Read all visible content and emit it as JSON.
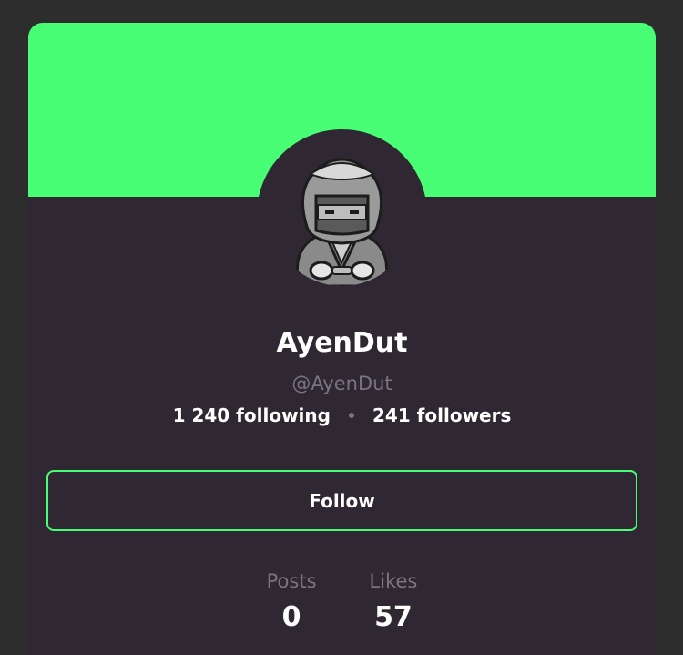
{
  "profile": {
    "display_name": "AyenDut",
    "handle": "@AyenDut",
    "following": "1 240 following",
    "followers": "241 followers",
    "follow_label": "Follow",
    "avatar_icon": "hooded-ninja-avatar-icon"
  },
  "counters": [
    {
      "label": "Posts",
      "value": "0"
    },
    {
      "label": "Likes",
      "value": "57"
    }
  ],
  "colors": {
    "accent": "#47fe75",
    "card_background": "#2f2833",
    "page_background": "#2d2d2d",
    "muted_text": "#7a7480"
  }
}
